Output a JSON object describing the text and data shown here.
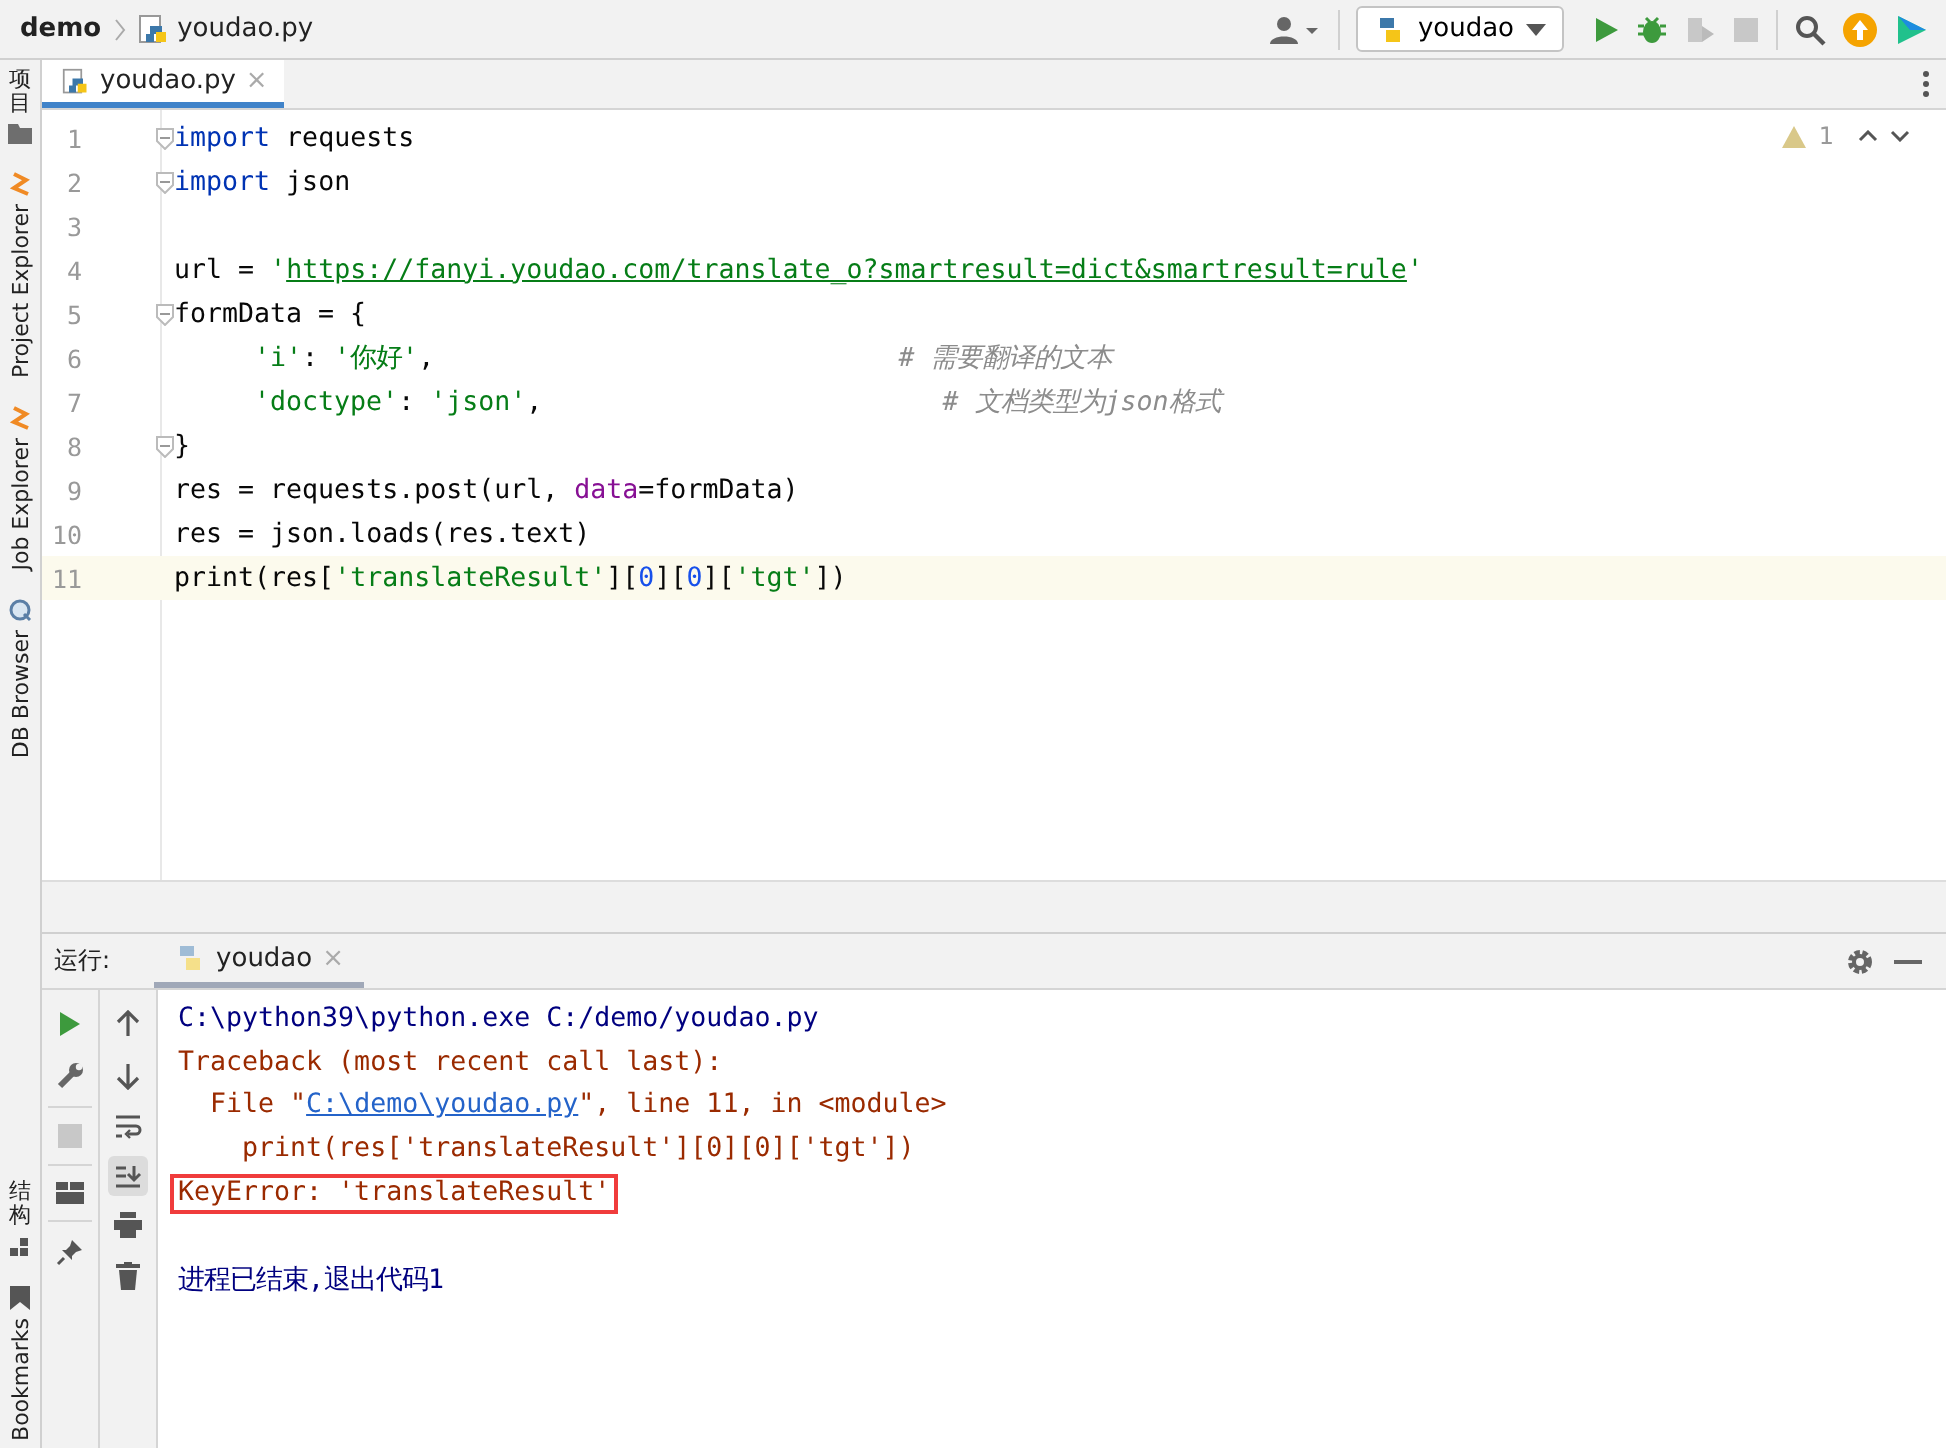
{
  "breadcrumb": {
    "project": "demo",
    "file": "youdao.py"
  },
  "toolbar": {
    "run_config": "youdao",
    "coverage": {
      "disabled": true
    },
    "stop": {
      "disabled": true
    }
  },
  "side_tools": {
    "top": [
      {
        "label": "项目",
        "cjk": true
      },
      {
        "label": "Project Explorer",
        "cjk": false
      },
      {
        "label": "Job Explorer",
        "cjk": false
      },
      {
        "label": "DB Browser",
        "cjk": false
      }
    ],
    "bottom": [
      {
        "label": "结构",
        "cjk": true
      },
      {
        "label": "Bookmarks",
        "cjk": false
      }
    ]
  },
  "editor_tabs": [
    {
      "label": "youdao.py",
      "close": "×",
      "selected": true
    }
  ],
  "inspections": {
    "warnings": "1"
  },
  "code_lines": [
    {
      "number": "1",
      "fold": true,
      "current": false,
      "tokens": [
        {
          "kind": "keyword",
          "text": "import"
        },
        {
          "kind": "plain",
          "text": " requests"
        }
      ]
    },
    {
      "number": "2",
      "fold": true,
      "current": false,
      "tokens": [
        {
          "kind": "keyword",
          "text": "import"
        },
        {
          "kind": "plain",
          "text": " json"
        }
      ]
    },
    {
      "number": "3",
      "fold": false,
      "current": false
    },
    {
      "number": "4",
      "fold": false,
      "current": false,
      "tokens": [
        {
          "kind": "plain",
          "text": "url = "
        },
        {
          "kind": "string",
          "text": "'"
        },
        {
          "kind": "link",
          "text": "https://fanyi.youdao.com/translate_o?smartresult=dict&smartresult=rule"
        },
        {
          "kind": "string",
          "text": "'"
        }
      ]
    },
    {
      "number": "5",
      "fold": true,
      "current": false,
      "tokens": [
        {
          "kind": "plain",
          "text": "formData = {"
        }
      ]
    },
    {
      "number": "6",
      "fold": false,
      "current": false,
      "indented": true,
      "tokens": [
        {
          "kind": "string",
          "text": "'i'"
        },
        {
          "kind": "plain",
          "text": ": "
        },
        {
          "kind": "string",
          "text": "'你好'"
        },
        {
          "kind": "plain",
          "text": ",                             "
        },
        {
          "kind": "comment",
          "text": "# 需要翻译的文本"
        }
      ]
    },
    {
      "number": "7",
      "fold": false,
      "current": false,
      "indented": true,
      "tokens": [
        {
          "kind": "string",
          "text": "'doctype'"
        },
        {
          "kind": "plain",
          "text": ": "
        },
        {
          "kind": "string",
          "text": "'json'"
        },
        {
          "kind": "plain",
          "text": ",                         "
        },
        {
          "kind": "comment",
          "text": "# 文档类型为json格式"
        }
      ]
    },
    {
      "number": "8",
      "fold": true,
      "current": false,
      "tokens": [
        {
          "kind": "plain",
          "text": "}"
        }
      ]
    },
    {
      "number": "9",
      "fold": false,
      "current": false,
      "tokens": [
        {
          "kind": "plain",
          "text": "res = requests.post(url, "
        },
        {
          "kind": "param",
          "text": "data"
        },
        {
          "kind": "plain",
          "text": "=formData)"
        }
      ]
    },
    {
      "number": "10",
      "fold": false,
      "current": false,
      "tokens": [
        {
          "kind": "plain",
          "text": "res = json.loads(res.text)"
        }
      ]
    },
    {
      "number": "11",
      "fold": false,
      "current": true,
      "tokens": [
        {
          "kind": "plain",
          "text": "print(res["
        },
        {
          "kind": "string",
          "text": "'translateResult'"
        },
        {
          "kind": "plain",
          "text": "]["
        },
        {
          "kind": "number",
          "text": "0"
        },
        {
          "kind": "plain",
          "text": "]["
        },
        {
          "kind": "number",
          "text": "0"
        },
        {
          "kind": "plain",
          "text": "]["
        },
        {
          "kind": "string",
          "text": "'tgt'"
        },
        {
          "kind": "plain",
          "text": "])"
        }
      ]
    }
  ],
  "run_panel": {
    "label": "运行:",
    "tabs": [
      {
        "label": "youdao",
        "close": "×",
        "selected": true
      }
    ],
    "scroll_to_end": {
      "on": true
    },
    "stop": {
      "disabled": true
    },
    "output": [
      {
        "kind": "command",
        "highlighted": false,
        "parts": [
          {
            "kind": "text",
            "text": "C:\\python39\\python.exe C:/demo/youdao.py"
          }
        ]
      },
      {
        "kind": "error",
        "highlighted": false,
        "parts": [
          {
            "kind": "text",
            "text": "Traceback (most recent call last):"
          }
        ]
      },
      {
        "kind": "error",
        "highlighted": false,
        "parts": [
          {
            "kind": "text",
            "text": "  File \""
          },
          {
            "kind": "link",
            "text": "C:\\demo\\youdao.py"
          },
          {
            "kind": "text",
            "text": "\", line 11, in <module>"
          }
        ]
      },
      {
        "kind": "error",
        "highlighted": false,
        "parts": [
          {
            "kind": "text",
            "text": "    print(res['translateResult'][0][0]['tgt'])"
          }
        ]
      },
      {
        "kind": "error",
        "highlighted": true,
        "parts": [
          {
            "kind": "text",
            "text": "KeyError: 'translateResult'"
          }
        ]
      },
      {
        "kind": "blank",
        "highlighted": false
      },
      {
        "kind": "command",
        "highlighted": false,
        "parts": [
          {
            "kind": "text",
            "text": "进程已结束,退出代码1"
          }
        ]
      }
    ]
  }
}
